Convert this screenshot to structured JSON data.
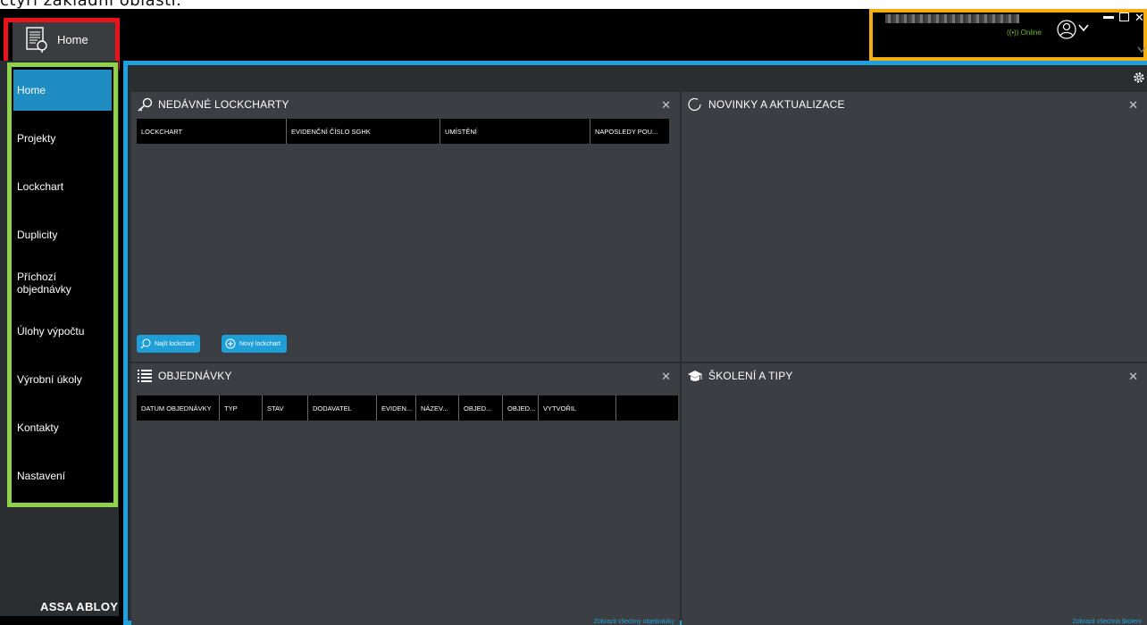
{
  "caption": "čtyři základní oblasti.",
  "app": {
    "home_button_label": "Home",
    "brand": "ASSA ABLOY"
  },
  "nav": {
    "items": [
      {
        "label": "Home",
        "active": true
      },
      {
        "label": "Projekty",
        "active": false
      },
      {
        "label": "Lockchart",
        "active": false
      },
      {
        "label": "Duplicity",
        "active": false
      },
      {
        "label": "Příchozí objednávky",
        "active": false
      },
      {
        "label": "Úlohy výpočtu",
        "active": false
      },
      {
        "label": "Výrobní úkoly",
        "active": false
      },
      {
        "label": "Kontakty",
        "active": false
      },
      {
        "label": "Nastavení",
        "active": false
      }
    ]
  },
  "account": {
    "status": "((•)) Online"
  },
  "panels": {
    "recent": {
      "title": "NEDÁVNÉ LOCKCHARTY",
      "columns": [
        "LOCKCHART",
        "EVIDENČNÍ ČÍSLO SGHK",
        "UMÍSTĚNÍ",
        "NAPOSLEDY POU..."
      ],
      "find_button": "Najít lockchart",
      "new_button": "Nový lockchart"
    },
    "news": {
      "title": "NOVINKY A AKTUALIZACE"
    },
    "orders": {
      "title": "OBJEDNÁVKY",
      "columns": [
        "DATUM OBJEDNÁVKY",
        "TYP",
        "STAV",
        "DODAVATEL",
        "EVIDEN...",
        "NÁZEV...",
        "OBJED...",
        "OBJED...",
        "VYTVOŘIL",
        ""
      ],
      "footer_link": "Zobrazit všechny objednávky"
    },
    "training": {
      "title": "ŠKOLENÍ A TIPY",
      "footer_link": "Zobrazit všechna školení"
    }
  },
  "colors": {
    "accent": "#1ea1dd",
    "nav_active": "#1f8cc2",
    "frame_red": "#e8131b",
    "frame_green": "#8ed14a",
    "frame_yellow": "#f5ad0f",
    "online": "#6fbe2c"
  }
}
